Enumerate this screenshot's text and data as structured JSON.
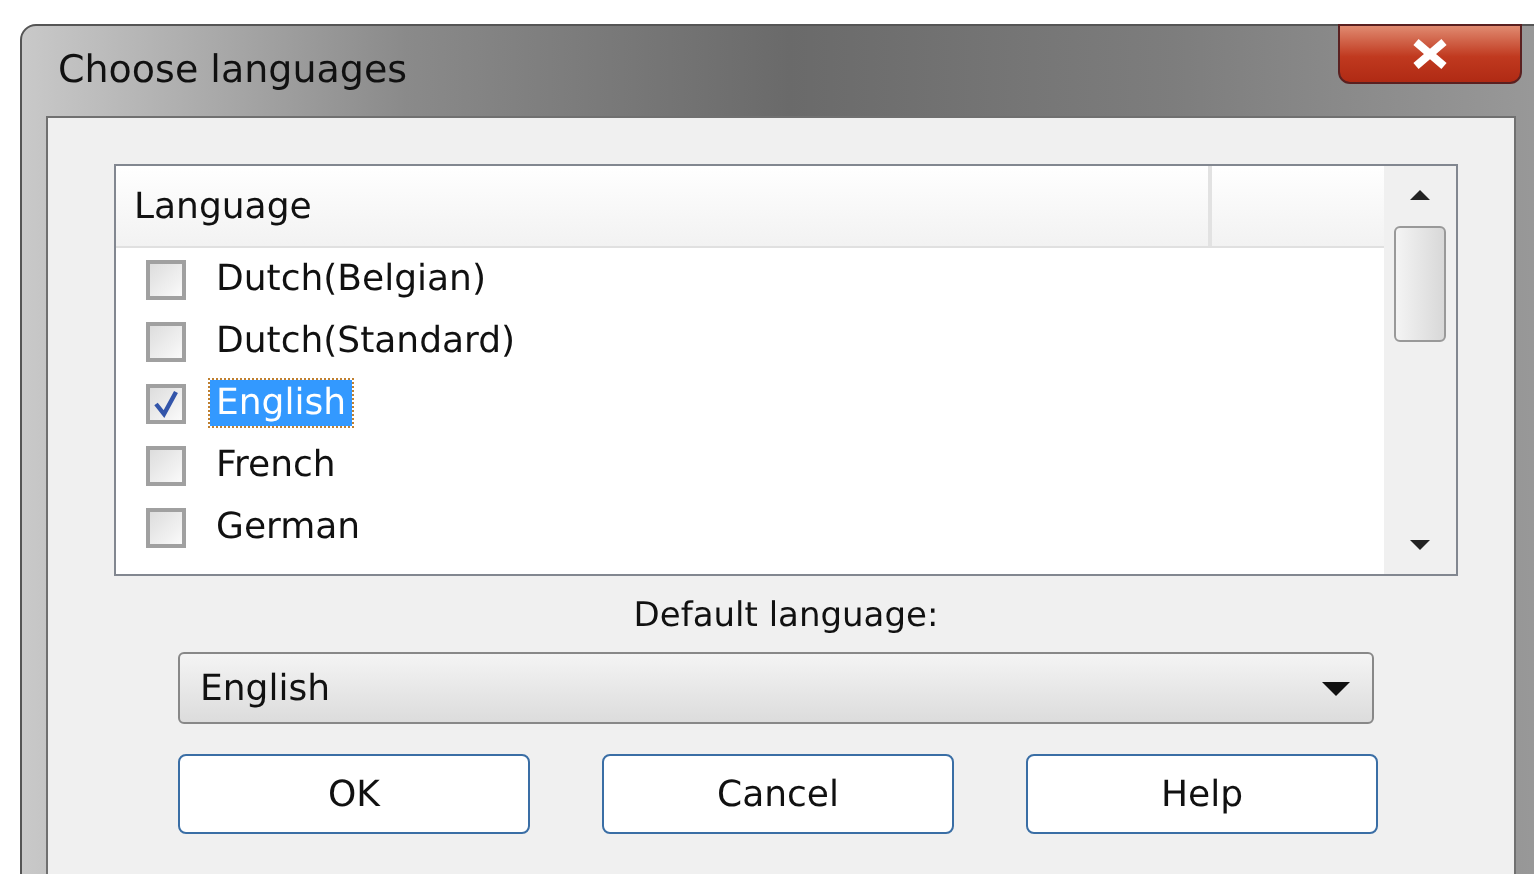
{
  "window": {
    "title": "Choose languages"
  },
  "list": {
    "column_1": "Language",
    "items": [
      {
        "label": "Dutch(Belgian)",
        "checked": false,
        "selected": false
      },
      {
        "label": "Dutch(Standard)",
        "checked": false,
        "selected": false
      },
      {
        "label": "English",
        "checked": true,
        "selected": true
      },
      {
        "label": "French",
        "checked": false,
        "selected": false
      },
      {
        "label": "German",
        "checked": false,
        "selected": false
      }
    ]
  },
  "default_language": {
    "label": "Default language:",
    "value": "English"
  },
  "buttons": [
    "OK",
    "Cancel",
    "Help"
  ]
}
